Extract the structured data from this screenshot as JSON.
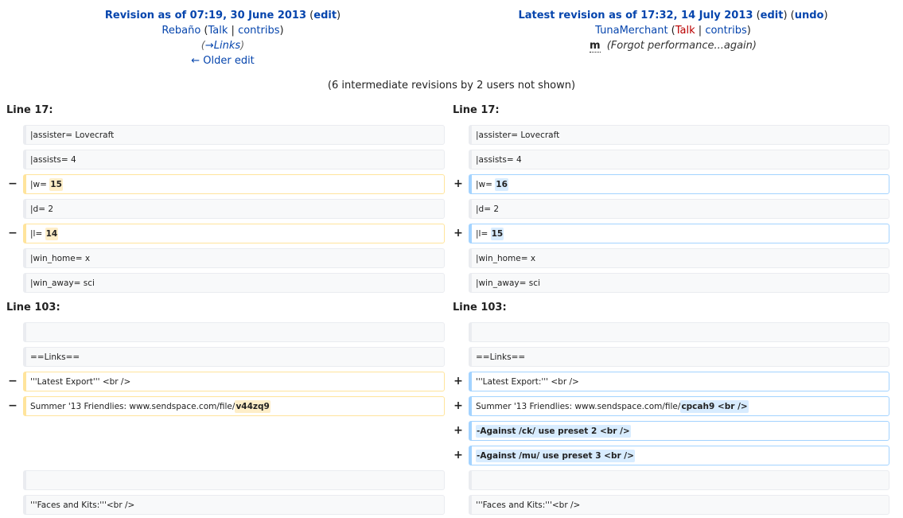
{
  "left_header": {
    "title": "Revision as of 07:19, 30 June 2013",
    "edit": "edit",
    "user": "Rebaño",
    "talk": "Talk",
    "contribs": "contribs",
    "autocomment": "→Links",
    "older_edit": "← Older edit"
  },
  "right_header": {
    "title": "Latest revision as of 17:32, 14 July 2013",
    "edit": "edit",
    "undo": "undo",
    "user": "TunaMerchant",
    "talk": "Talk",
    "contribs": "contribs",
    "minor": "m",
    "summary": "(Forgot performance...again)"
  },
  "intermediate": "(6 intermediate revisions by 2 users not shown)",
  "sections": [
    {
      "left": "Line 17:",
      "right": "Line 17:"
    },
    {
      "left": "Line 103:",
      "right": "Line 103:"
    }
  ],
  "rows": {
    "s1": {
      "r1": {
        "left": "|assister= Lovecraft",
        "right": "|assister= Lovecraft"
      },
      "r2": {
        "left": "|assists= 4",
        "right": "|assists= 4"
      },
      "r3": {
        "left_pre": "|w= ",
        "left_hl": "15",
        "right_pre": "|w= ",
        "right_hl": "16"
      },
      "r4": {
        "left": "|d= 2",
        "right": "|d= 2"
      },
      "r5": {
        "left_pre": "|l= ",
        "left_hl": "14",
        "right_pre": "|l= ",
        "right_hl": "15"
      },
      "r6": {
        "left": "|win_home= x",
        "right": "|win_home= x"
      },
      "r7": {
        "left": "|win_away= sci",
        "right": "|win_away= sci"
      }
    },
    "s2": {
      "r1": {
        "left": "",
        "right": ""
      },
      "r2": {
        "left": "==Links==",
        "right": "==Links=="
      },
      "r3": {
        "left": "'''Latest Export''' <br />",
        "right": "'''Latest Export:''' <br />"
      },
      "r4": {
        "left_pre": "Summer '13 Friendlies: www.sendspace.com/file/",
        "left_hl": "v44zq9",
        "right_pre": "Summer '13 Friendlies: www.sendspace.com/file/",
        "right_hl": "cpcah9 <br />"
      },
      "r5": {
        "right_hl": "-Against /ck/ use preset 2 <br />"
      },
      "r6": {
        "right_hl": "-Against /mu/ use preset 3 <br />"
      },
      "r7": {
        "left": "",
        "right": ""
      },
      "r8": {
        "left": "'''Faces and Kits:'''<br />",
        "right": "'''Faces and Kits:'''<br />"
      }
    }
  },
  "markers": {
    "minus": "−",
    "plus": "+"
  }
}
